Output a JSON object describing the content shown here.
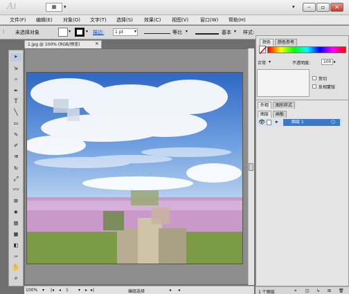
{
  "app": {
    "logo": "Ai"
  },
  "titlebar": {
    "arrange_icon": "arrange-documents-icon",
    "workspace_dd": "▾"
  },
  "menu": [
    "文件(F)",
    "编辑(E)",
    "对象(O)",
    "文字(T)",
    "选择(S)",
    "效果(C)",
    "视图(V)",
    "窗口(W)",
    "帮助(H)"
  ],
  "control": {
    "selection": "未选择对象",
    "stroke_label": "描边:",
    "stroke_weight": "1 pt",
    "profile": "等比",
    "brush": "基本",
    "style_label": "样式:"
  },
  "document": {
    "tab_title": "1.jpg @ 100% (RGB/预览)",
    "close": "×",
    "zoom": "100%",
    "page": "1",
    "status": "编组选择"
  },
  "color_panel": {
    "tab_color": "颜色",
    "tab_color_ref": "颜色参考",
    "blend_mode": "正常",
    "opacity_label": "不透明度:",
    "opacity_value": "100",
    "clip_label": "剪切",
    "invert_label": "反相蒙版"
  },
  "appearance_panel": {
    "tab_appearance": "外观",
    "tab_graphic_styles": "图形样式",
    "tab_layers": "图层",
    "tab_artboards": "画板",
    "layer_name": "图层 1",
    "footer_count": "1 个图层"
  }
}
